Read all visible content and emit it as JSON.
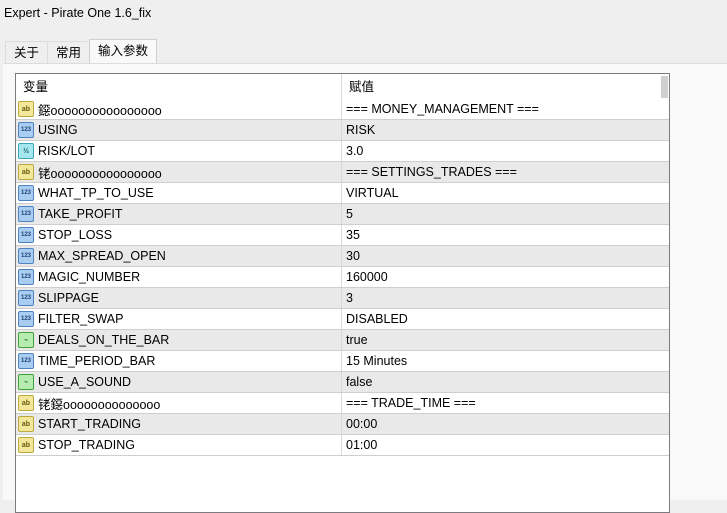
{
  "window": {
    "title": "Expert - Pirate One 1.6_fix"
  },
  "tabs": [
    {
      "label": "关于"
    },
    {
      "label": "常用"
    },
    {
      "label": "输入参数",
      "active": true
    }
  ],
  "table": {
    "headers": {
      "variable": "变量",
      "value": "赋值"
    },
    "rows": [
      {
        "icon": "string-icon",
        "name": "鐚oooooooooooooooo",
        "value": "=== MONEY_MANAGEMENT ==="
      },
      {
        "icon": "integer-icon",
        "name": "USING",
        "value": "RISK"
      },
      {
        "icon": "double-icon",
        "name": "RISK/LOT",
        "value": "3.0"
      },
      {
        "icon": "string-icon",
        "name": "铑oooooooooooooooo",
        "value": "=== SETTINGS_TRADES ==="
      },
      {
        "icon": "integer-icon",
        "name": "WHAT_TP_TO_USE",
        "value": "VIRTUAL"
      },
      {
        "icon": "integer-icon",
        "name": "TAKE_PROFIT",
        "value": "5"
      },
      {
        "icon": "integer-icon",
        "name": "STOP_LOSS",
        "value": "35"
      },
      {
        "icon": "integer-icon",
        "name": "MAX_SPREAD_OPEN",
        "value": "30"
      },
      {
        "icon": "integer-icon",
        "name": "MAGIC_NUMBER",
        "value": "160000"
      },
      {
        "icon": "integer-icon",
        "name": "SLIPPAGE",
        "value": "3"
      },
      {
        "icon": "integer-icon",
        "name": "FILTER_SWAP",
        "value": "DISABLED"
      },
      {
        "icon": "bool-icon",
        "name": "DEALS_ON_THE_BAR",
        "value": "true"
      },
      {
        "icon": "integer-icon",
        "name": "TIME_PERIOD_BAR",
        "value": "15 Minutes"
      },
      {
        "icon": "bool-icon",
        "name": "USE_A_SOUND",
        "value": "false"
      },
      {
        "icon": "string-icon",
        "name": "铑鐚oooooooooooooo",
        "value": "=== TRADE_TIME ==="
      },
      {
        "icon": "string-icon",
        "name": "START_TRADING",
        "value": "00:00"
      },
      {
        "icon": "string-icon",
        "name": "STOP_TRADING",
        "value": "01:00"
      }
    ]
  },
  "icon_labels": {
    "string-icon": "ab",
    "integer-icon": "123",
    "double-icon": "½",
    "bool-icon": "⌁"
  }
}
